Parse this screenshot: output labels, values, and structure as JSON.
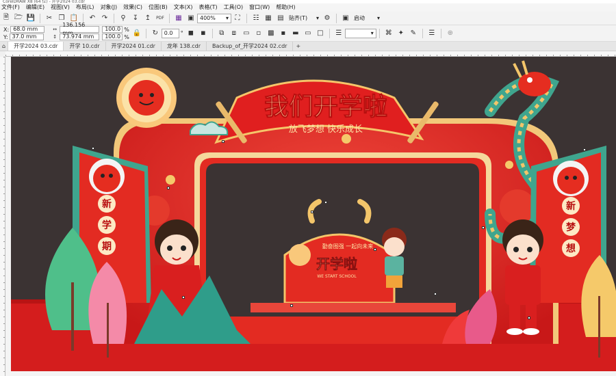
{
  "window": {
    "title": "CorelDRAW X8 (64 位) - 开学2024 03.cdr"
  },
  "menu": [
    "文件(F)",
    "编辑(E)",
    "视图(V)",
    "布局(L)",
    "对象(J)",
    "效果(C)",
    "位图(B)",
    "文本(X)",
    "表格(T)",
    "工具(O)",
    "窗口(W)",
    "帮助(H)"
  ],
  "toolbar1": {
    "zoom": "400%",
    "snap_label": "贴齐(T)",
    "launch_label": "启动"
  },
  "toolbar2": {
    "x_label": "X:",
    "x_value": "68.0 mm",
    "y_label": "Y:",
    "y_value": "37.0 mm",
    "w_value": "136.156 mm",
    "h_value": "73.974 mm",
    "sx_value": "100.0",
    "sy_value": "100.0",
    "pct": "%",
    "angle_value": "0.0",
    "degree": "°"
  },
  "doc_tabs": [
    "开学2024 03.cdr",
    "开学 10.cdr",
    "开学2024 01.cdr",
    "龙年 138.cdr",
    "Backup_of_开学2024 02.cdr"
  ],
  "artwork": {
    "headline": "我们开学啦",
    "slogan": "放飞梦想 快乐成长",
    "left_banner": [
      "新",
      "学",
      "期"
    ],
    "right_banner": [
      "新",
      "梦",
      "想"
    ],
    "board_title": "开学啦",
    "board_sub": "WE START SCHOOL",
    "board_arc": "勤奋图强 一起向未来"
  },
  "colors": {
    "red": "#d91f1f",
    "dark_red": "#b01010",
    "gold": "#f3c56a",
    "cream": "#fde9c4",
    "bg": "#3b3333",
    "teal": "#3fa58e"
  }
}
